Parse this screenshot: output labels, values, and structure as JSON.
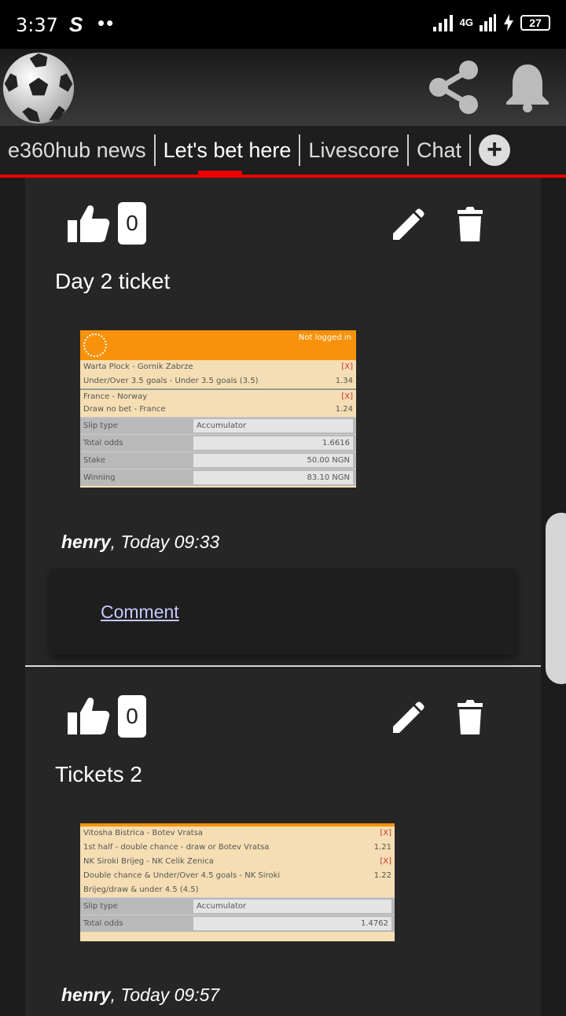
{
  "status_bar": {
    "time": "3:37",
    "app_glyph": "S",
    "dots": "••",
    "network": "4G",
    "battery": "27"
  },
  "app_bar": {
    "icons": [
      "soccer-ball-icon",
      "share-icon",
      "bell-icon"
    ]
  },
  "tabs": [
    {
      "label": "e360hub news"
    },
    {
      "label": "Let's bet here"
    },
    {
      "label": "Livescore"
    },
    {
      "label": "Chat"
    }
  ],
  "add_tab_label": "+",
  "posts": [
    {
      "likes": "0",
      "title": "Day 2 ticket",
      "ticket": {
        "header_text": "Not logged in",
        "selections": [
          {
            "match": "Warta Plock - Gornik Zabrze",
            "mark": "[X]"
          },
          {
            "match": "Under/Over 3.5 goals - Under 3.5 goals (3.5)",
            "mark": "1.34"
          },
          {
            "match": "France - Norway",
            "mark": "[X]"
          },
          {
            "match": "Draw no bet - France",
            "mark": "1.24"
          }
        ],
        "info": [
          {
            "key": "Slip type",
            "value": "Accumulator"
          },
          {
            "key": "Total odds",
            "value": "1.6616"
          },
          {
            "key": "Stake",
            "value": "50.00 NGN"
          },
          {
            "key": "Winning",
            "value": "83.10 NGN"
          }
        ]
      },
      "author": "henry",
      "time": ", Today 09:33",
      "comment_label": "Comment"
    },
    {
      "likes": "0",
      "title": "Tickets 2",
      "ticket": {
        "selections": [
          {
            "match": "Vitosha Bistrica - Botev Vratsa",
            "mark": "[X]"
          },
          {
            "match": "1st half - double chance - draw or Botev Vratsa",
            "mark": "1.21"
          },
          {
            "match": "NK Siroki Brijeg - NK Celik Zenica",
            "mark": "[X]"
          },
          {
            "match": "Double chance & Under/Over 4.5 goals - NK Siroki",
            "mark": "1.22"
          },
          {
            "match": "Brijeg/draw & under 4.5 (4.5)",
            "mark": ""
          }
        ],
        "info": [
          {
            "key": "Slip type",
            "value": "Accumulator"
          },
          {
            "key": "Total odds",
            "value": "1.4762"
          }
        ]
      },
      "author": "henry",
      "time": ", Today 09:57"
    }
  ]
}
